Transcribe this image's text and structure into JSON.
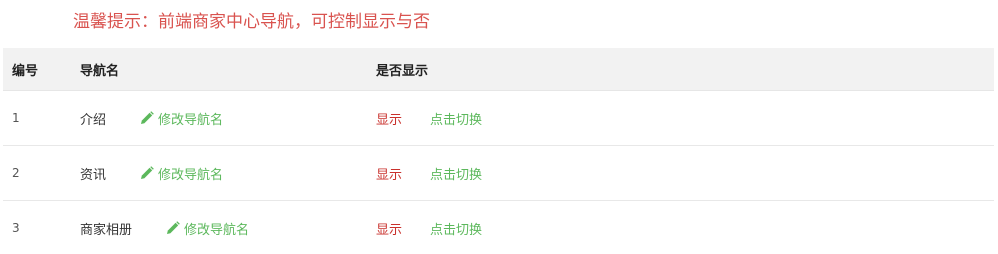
{
  "tip": "温馨提示：前端商家中心导航，可控制显示与否",
  "table": {
    "headers": {
      "id": "编号",
      "name": "导航名",
      "show": "是否显示"
    },
    "rows": [
      {
        "id": "1",
        "name": "介绍",
        "edit_label": "修改导航名",
        "status": "显示",
        "toggle_label": "点击切换"
      },
      {
        "id": "2",
        "name": "资讯",
        "edit_label": "修改导航名",
        "status": "显示",
        "toggle_label": "点击切换"
      },
      {
        "id": "3",
        "name": "商家相册",
        "edit_label": "修改导航名",
        "status": "显示",
        "toggle_label": "点击切换"
      }
    ]
  },
  "colors": {
    "tip": "#d9534f",
    "link": "#5cb85c",
    "status": "#c9302c",
    "header_bg": "#f2f2f2"
  },
  "icons": {
    "edit": "pencil-icon"
  }
}
